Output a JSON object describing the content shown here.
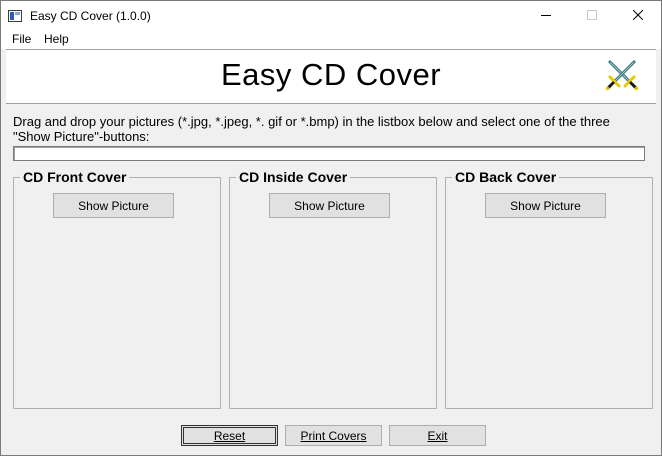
{
  "window": {
    "title": "Easy CD Cover (1.0.0)"
  },
  "menu": {
    "file": "File",
    "help": "Help"
  },
  "banner": {
    "title": "Easy CD Cover"
  },
  "instruction": {
    "text": "Drag and drop your pictures (*.jpg, *.jpeg, *. gif or *.bmp) in the listbox below and select one of the three \"Show Picture\"-buttons:"
  },
  "listbox": {
    "value": ""
  },
  "groups": {
    "front": {
      "title": "CD Front Cover",
      "button": "Show Picture"
    },
    "inside": {
      "title": "CD Inside Cover",
      "button": "Show Picture"
    },
    "back": {
      "title": "CD Back Cover",
      "button": "Show Picture"
    }
  },
  "buttons": {
    "reset": "Reset",
    "print": "Print Covers",
    "exit": "Exit"
  },
  "icons": {
    "app": "cd-cover-app-icon",
    "banner": "crossed-swords-icon",
    "minimize": "minimize-icon",
    "maximize": "maximize-icon",
    "close": "close-icon"
  },
  "colors": {
    "window_bg": "#f0f0f0",
    "button_bg": "#e1e1e1",
    "sword_blade": "#2d6b6b",
    "sword_hilt": "#e8c800"
  }
}
